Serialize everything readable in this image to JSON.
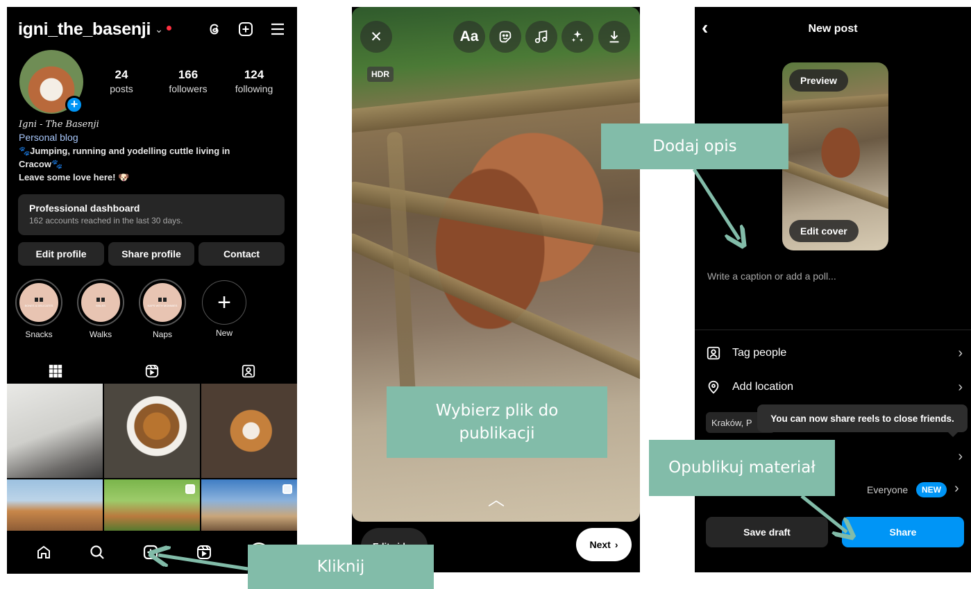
{
  "profile": {
    "username": "igni_the_basenji",
    "stats": [
      {
        "num": "24",
        "label": "posts"
      },
      {
        "num": "166",
        "label": "followers"
      },
      {
        "num": "124",
        "label": "following"
      }
    ],
    "bio_name": "Igni - The Basenji",
    "category": "Personal blog",
    "bio_line1": "🐾Jumping, running and yodelling cuttle living in",
    "bio_line2": "Cracow🐾",
    "bio_line3": "Leave some love here! 🐶",
    "dashboard_title": "Professional dashboard",
    "dashboard_sub": "162 accounts reached in the last 30 days.",
    "buttons": [
      "Edit profile",
      "Share profile",
      "Contact"
    ],
    "highlights": [
      {
        "label": "Snacks",
        "tag": "BONES & DELICATES"
      },
      {
        "label": "Walks",
        "tag": "WALKS"
      },
      {
        "label": "Naps",
        "tag": "NAPS WITH MOMMIES"
      }
    ],
    "new_highlight_label": "New"
  },
  "editor": {
    "text_tool": "Aa",
    "hdr": "HDR",
    "edit_video": "Edit video",
    "next": "Next"
  },
  "newpost": {
    "title": "New post",
    "preview": "Preview",
    "edit_cover": "Edit cover",
    "caption_placeholder": "Write a caption or add a poll...",
    "tag_people": "Tag people",
    "add_location": "Add location",
    "location_chip": "Kraków, P",
    "tooltip": "You can now share reels to close friends.",
    "audience_value": "Everyone",
    "new_badge": "NEW",
    "save_draft": "Save draft",
    "share": "Share"
  },
  "callouts": {
    "click": "Kliknij",
    "choose_file": "Wybierz plik do publikacji",
    "add_caption": "Dodaj opis",
    "publish": "Opublikuj materiał"
  },
  "colors": {
    "callout": "#82bca9",
    "accent_blue": "#0095f6",
    "notification_red": "#ff3040"
  }
}
